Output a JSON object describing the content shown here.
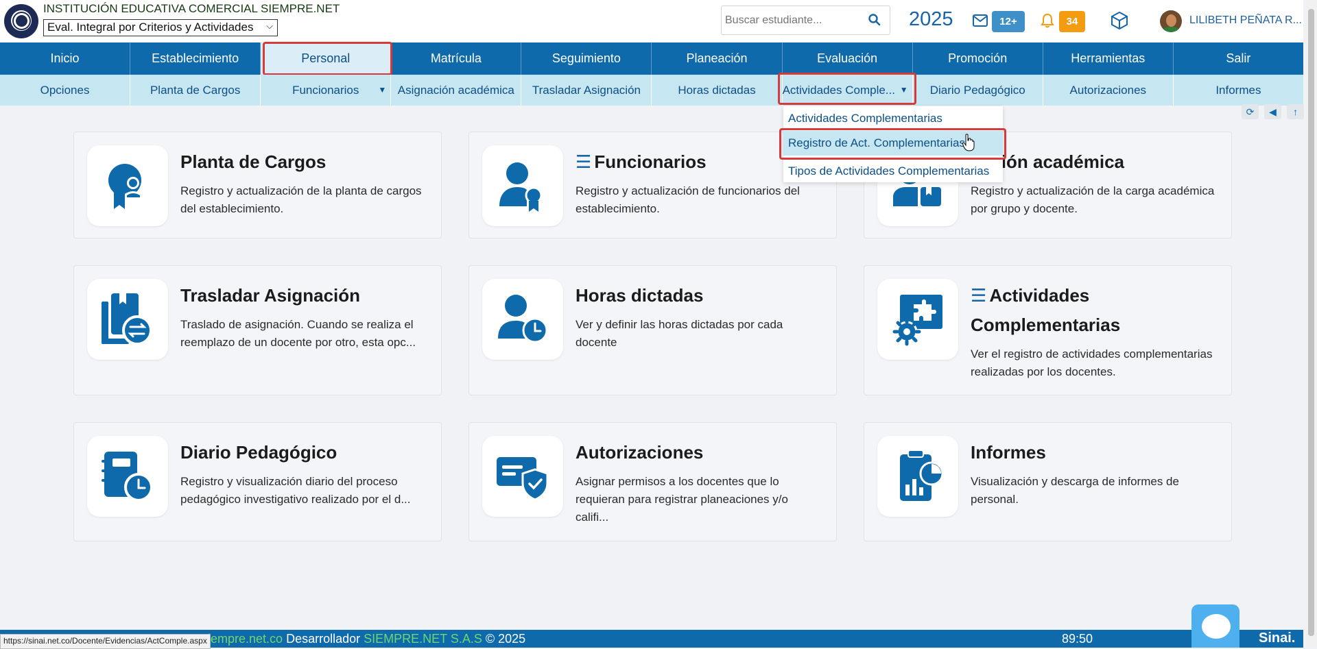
{
  "header": {
    "institution": "INSTITUCIÓN EDUCATIVA COMERCIAL SIEMPRE.NET",
    "period_selected": "Eval. Integral por Criterios y Actividades",
    "search_placeholder": "Buscar estudiante...",
    "year": "2025",
    "mail_count": "12+",
    "notif_count": "34",
    "user": "LILIBETH PEÑATA R..."
  },
  "main_nav": [
    {
      "label": "Inicio"
    },
    {
      "label": "Establecimiento"
    },
    {
      "label": "Personal"
    },
    {
      "label": "Matrícula"
    },
    {
      "label": "Seguimiento"
    },
    {
      "label": "Planeación"
    },
    {
      "label": "Evaluación"
    },
    {
      "label": "Promoción"
    },
    {
      "label": "Herramientas"
    },
    {
      "label": "Salir"
    }
  ],
  "sub_nav": [
    {
      "label": "Opciones"
    },
    {
      "label": "Planta de Cargos"
    },
    {
      "label": "Funcionarios"
    },
    {
      "label": "Asignación académica"
    },
    {
      "label": "Trasladar Asignación"
    },
    {
      "label": "Horas dictadas"
    },
    {
      "label": "Actividades Comple..."
    },
    {
      "label": "Diario Pedagógico"
    },
    {
      "label": "Autorizaciones"
    },
    {
      "label": "Informes"
    }
  ],
  "dropdown": [
    {
      "label": "Actividades Complementarias"
    },
    {
      "label": "Registro de Act. Complementarias"
    },
    {
      "label": "Tipos de Actividades Complementarias"
    }
  ],
  "cards": [
    {
      "title": "Planta de Cargos",
      "desc": "Registro y actualización de la planta de cargos del establecimiento."
    },
    {
      "title": "Funcionarios",
      "desc": "Registro y actualización de funcionarios del establecimiento."
    },
    {
      "title": "Asignación académica",
      "visible_title": "nación académica",
      "desc": "Registro y actualización de la carga académica por grupo y docente."
    },
    {
      "title": "Trasladar Asignación",
      "desc": "Traslado de asignación. Cuando se realiza el reemplazo de un docente por otro, esta opc..."
    },
    {
      "title": "Horas dictadas",
      "desc": "Ver y definir las horas dictadas por cada docente"
    },
    {
      "title": "Actividades Complementarias",
      "desc": "Ver el registro de actividades complementarias realizadas por los docentes."
    },
    {
      "title": "Diario Pedagógico",
      "desc": "Registro y visualización diario del proceso pedagógico investigativo realizado por el d..."
    },
    {
      "title": "Autorizaciones",
      "desc": "Asignar permisos a los docentes que lo requieran para registrar planeaciones y/o califi..."
    },
    {
      "title": "Informes",
      "desc": "Visualización y descarga de informes de personal."
    }
  ],
  "footer": {
    "status_url": "https://sinai.net.co/Docente/Evidencias/ActComple.aspx",
    "site": "iempre.net.co",
    "dev_label": "Desarrollador",
    "company": "SIEMPRE.NET S.A.S",
    "copyright": "© 2025",
    "timer": "89:50",
    "brand": "Sinai."
  },
  "colors": {
    "primary": "#0f6aab",
    "sub_nav_bg": "#c6e6f1",
    "highlight": "#d63a3a",
    "notif_badge": "#f39c12",
    "mail_badge": "#3f8fc9"
  }
}
